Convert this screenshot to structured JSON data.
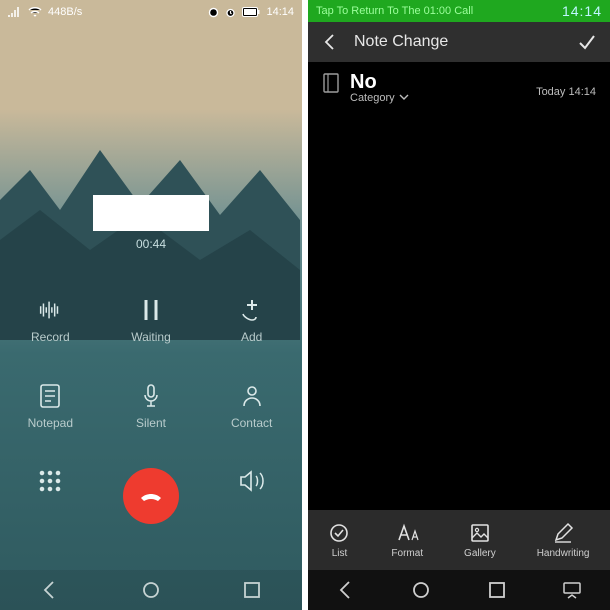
{
  "left": {
    "status": {
      "net": "448B/s",
      "time": "14:14"
    },
    "call": {
      "duration": "00:44"
    },
    "actions": {
      "record": "Record",
      "waiting": "Waiting",
      "add": "Add",
      "notepad": "Notepad",
      "silent": "Silent",
      "contact": "Contact"
    }
  },
  "right": {
    "returnbar": "Tap To Return To The 01:00 Call",
    "clock": "14:14",
    "header": "Note Change",
    "note": {
      "title": "No",
      "category": "Category",
      "timestamp": "Today 14:14"
    },
    "toolbar": {
      "list": "List",
      "format": "Format",
      "gallery": "Gallery",
      "handwriting": "Handwriting"
    }
  }
}
